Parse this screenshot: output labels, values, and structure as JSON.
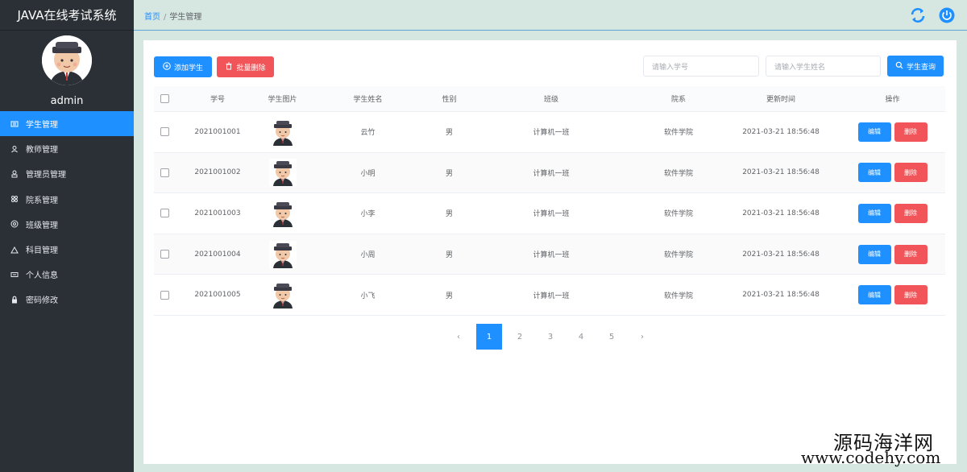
{
  "app": {
    "title": "JAVA在线考试系统"
  },
  "user": {
    "name": "admin"
  },
  "sidebar": {
    "items": [
      {
        "label": "学生管理",
        "icon": "student-icon",
        "active": true
      },
      {
        "label": "教师管理",
        "icon": "teacher-icon",
        "active": false
      },
      {
        "label": "管理员管理",
        "icon": "admin-icon",
        "active": false
      },
      {
        "label": "院系管理",
        "icon": "department-icon",
        "active": false
      },
      {
        "label": "班级管理",
        "icon": "class-icon",
        "active": false
      },
      {
        "label": "科目管理",
        "icon": "subject-icon",
        "active": false
      },
      {
        "label": "个人信息",
        "icon": "profile-icon",
        "active": false
      },
      {
        "label": "密码修改",
        "icon": "lock-icon",
        "active": false
      }
    ]
  },
  "breadcrumb": {
    "home": "首页",
    "separator": "/",
    "current": "学生管理"
  },
  "toolbar": {
    "add_label": "添加学生",
    "batch_delete_label": "批量删除",
    "search_id_placeholder": "请输入学号",
    "search_name_placeholder": "请输入学生姓名",
    "query_label": "学生查询"
  },
  "table": {
    "headers": {
      "id": "学号",
      "image": "学生图片",
      "name": "学生姓名",
      "sex": "性别",
      "class": "班级",
      "dept": "院系",
      "time": "更新时间",
      "op": "操作"
    },
    "edit_label": "编辑",
    "delete_label": "删除",
    "rows": [
      {
        "id": "2021001001",
        "name": "云竹",
        "sex": "男",
        "class": "计算机一班",
        "dept": "软件学院",
        "time": "2021-03-21 18:56:48"
      },
      {
        "id": "2021001002",
        "name": "小明",
        "sex": "男",
        "class": "计算机一班",
        "dept": "软件学院",
        "time": "2021-03-21 18:56:48"
      },
      {
        "id": "2021001003",
        "name": "小李",
        "sex": "男",
        "class": "计算机一班",
        "dept": "软件学院",
        "time": "2021-03-21 18:56:48"
      },
      {
        "id": "2021001004",
        "name": "小周",
        "sex": "男",
        "class": "计算机一班",
        "dept": "软件学院",
        "time": "2021-03-21 18:56:48"
      },
      {
        "id": "2021001005",
        "name": "小飞",
        "sex": "男",
        "class": "计算机一班",
        "dept": "软件学院",
        "time": "2021-03-21 18:56:48"
      }
    ]
  },
  "pagination": {
    "prev": "‹",
    "next": "›",
    "pages": [
      "1",
      "2",
      "3",
      "4",
      "5"
    ],
    "current": "1"
  },
  "watermark": {
    "line1": "源码海洋网",
    "line2": "www.codehy.com"
  },
  "colors": {
    "primary": "#1e90ff",
    "danger": "#f25559",
    "sidebar": "#2b3037",
    "background": "#d6e6e1"
  }
}
